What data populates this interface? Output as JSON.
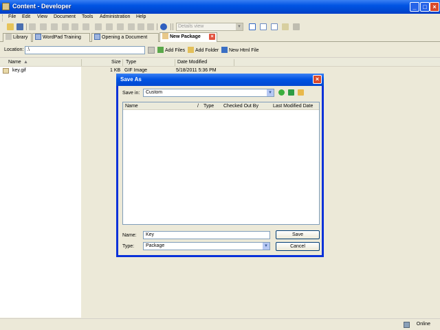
{
  "window": {
    "title": "Content - Developer"
  },
  "menu": [
    "File",
    "Edit",
    "View",
    "Document",
    "Tools",
    "Administration",
    "Help"
  ],
  "toolbar": {
    "view_select": "Details view"
  },
  "tabs": [
    {
      "label": "Library"
    },
    {
      "label": "WordPad Training"
    },
    {
      "label": "Opening a Document"
    },
    {
      "label": "New Package",
      "active": true
    }
  ],
  "location": {
    "label": "Location:",
    "value": ".\\",
    "actions": [
      "Add Files",
      "Add Folder",
      "New Html File"
    ]
  },
  "file_list": {
    "columns": [
      "Name",
      "Size",
      "Type",
      "Date Modified"
    ],
    "rows": [
      {
        "name": "key.gif",
        "size": "1 KB",
        "type": "GIF Image",
        "date": "5/18/2011 5:36 PM"
      }
    ]
  },
  "dialog": {
    "title": "Save As",
    "save_in_label": "Save in:",
    "save_in_value": "Custom",
    "columns": [
      "Name",
      "/",
      "Type",
      "Checked Out By",
      "Last Modified Date"
    ],
    "name_label": "Name:",
    "name_value": "Key",
    "type_label": "Type:",
    "type_value": "Package",
    "save_button": "Save",
    "cancel_button": "Cancel"
  },
  "status": {
    "text": "Online"
  },
  "colors": {
    "titlebar": "#0054e3",
    "dialog_border": "#0831d9",
    "close": "#d94a2b"
  }
}
